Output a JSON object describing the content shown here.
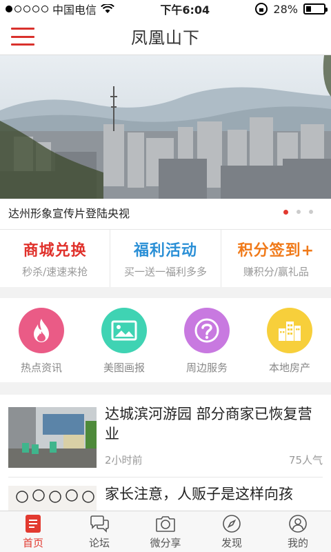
{
  "status_bar": {
    "carrier": "中国电信",
    "time": "下午6:04",
    "battery": "28%",
    "battery_level": 0.28
  },
  "header": {
    "title": "凤凰山下"
  },
  "banner": {
    "caption": "达州形象宣传片登陆央视",
    "slide_count": 3,
    "active_slide": 0
  },
  "promos": [
    {
      "title": "商城兑换",
      "subtitle": "秒杀/速速来抢",
      "color": "#e0312b"
    },
    {
      "title": "福利活动",
      "subtitle": "买一送一福利多多",
      "color": "#2a8fd6"
    },
    {
      "title": "积分签到+",
      "subtitle": "赚积分/赢礼品",
      "color": "#f07a1a"
    }
  ],
  "categories": [
    {
      "label": "热点资讯",
      "icon": "flame-icon",
      "color": "#ea5b86"
    },
    {
      "label": "美图画报",
      "icon": "picture-icon",
      "color": "#3fd3b3"
    },
    {
      "label": "周边服务",
      "icon": "question-icon",
      "color": "#c879e0"
    },
    {
      "label": "本地房产",
      "icon": "buildings-icon",
      "color": "#f7cf3b"
    }
  ],
  "news": [
    {
      "title": "达城滨河游园 部分商家已恢复营业",
      "time": "2小时前",
      "popularity": "75人气"
    },
    {
      "title": "家长注意，人贩子是这样向孩"
    }
  ],
  "tabs": [
    {
      "label": "首页",
      "icon": "home-doc-icon",
      "active": true
    },
    {
      "label": "论坛",
      "icon": "chat-bubbles-icon",
      "active": false
    },
    {
      "label": "微分享",
      "icon": "camera-icon",
      "active": false
    },
    {
      "label": "发现",
      "icon": "compass-icon",
      "active": false
    },
    {
      "label": "我的",
      "icon": "user-icon",
      "active": false
    }
  ]
}
